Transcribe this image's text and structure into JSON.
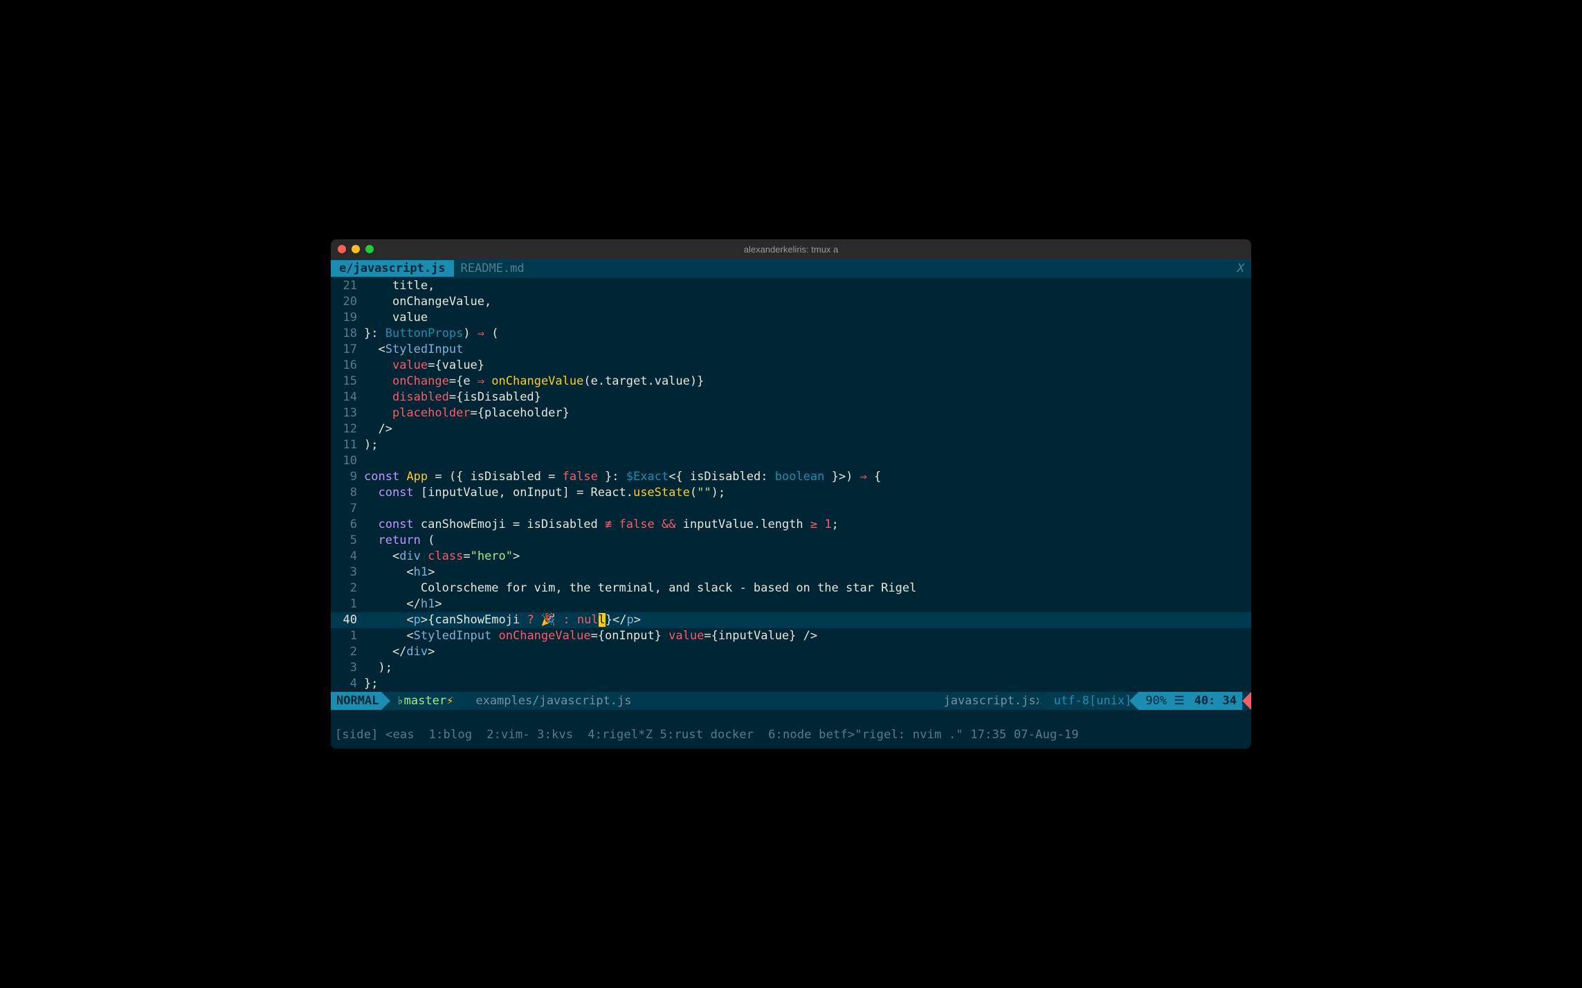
{
  "window": {
    "title": "alexanderkeliris: tmux a"
  },
  "tabs": {
    "active": "e/javascript.js",
    "inactive": "README.md",
    "close": "X"
  },
  "lines": [
    {
      "n": "21",
      "rel": false,
      "tokens": [
        [
          "fg",
          "    "
        ],
        [
          "fg",
          "title"
        ],
        [
          "fg",
          ","
        ]
      ]
    },
    {
      "n": "20",
      "rel": false,
      "tokens": [
        [
          "fg",
          "    "
        ],
        [
          "fg",
          "onChangeValue"
        ],
        [
          "fg",
          ","
        ]
      ]
    },
    {
      "n": "19",
      "rel": false,
      "tokens": [
        [
          "fg",
          "    "
        ],
        [
          "fg",
          "value"
        ]
      ]
    },
    {
      "n": "18",
      "rel": false,
      "tokens": [
        [
          "fg",
          "}: "
        ],
        [
          "type",
          "ButtonProps"
        ],
        [
          "fg",
          ") "
        ],
        [
          "op",
          "⇒"
        ],
        [
          "fg",
          " ("
        ]
      ]
    },
    {
      "n": "17",
      "rel": false,
      "tokens": [
        [
          "fg",
          "  "
        ],
        [
          "fg",
          "<"
        ],
        [
          "comp",
          "StyledInput"
        ]
      ]
    },
    {
      "n": "16",
      "rel": false,
      "tokens": [
        [
          "fg",
          "    "
        ],
        [
          "attr",
          "value"
        ],
        [
          "fg",
          "={value}"
        ]
      ]
    },
    {
      "n": "15",
      "rel": false,
      "tokens": [
        [
          "fg",
          "    "
        ],
        [
          "attr",
          "onChange"
        ],
        [
          "fg",
          "={e "
        ],
        [
          "op",
          "⇒"
        ],
        [
          "fg",
          " "
        ],
        [
          "fn",
          "onChangeValue"
        ],
        [
          "fg",
          "(e.target.value)}"
        ]
      ]
    },
    {
      "n": "14",
      "rel": false,
      "tokens": [
        [
          "fg",
          "    "
        ],
        [
          "attr",
          "disabled"
        ],
        [
          "fg",
          "={isDisabled}"
        ]
      ]
    },
    {
      "n": "13",
      "rel": false,
      "tokens": [
        [
          "fg",
          "    "
        ],
        [
          "attr",
          "placeholder"
        ],
        [
          "fg",
          "={placeholder}"
        ]
      ]
    },
    {
      "n": "12",
      "rel": false,
      "tokens": [
        [
          "fg",
          "  "
        ],
        [
          "fg",
          "/>"
        ]
      ]
    },
    {
      "n": "11",
      "rel": false,
      "tokens": [
        [
          "fg",
          ");"
        ]
      ]
    },
    {
      "n": "10",
      "rel": false,
      "tokens": [
        [
          "fg",
          ""
        ]
      ]
    },
    {
      "n": "9",
      "rel": false,
      "tokens": [
        [
          "kw",
          "const"
        ],
        [
          "fg",
          " "
        ],
        [
          "fn",
          "App"
        ],
        [
          "fg",
          " = ({ isDisabled = "
        ],
        [
          "val",
          "false"
        ],
        [
          "fg",
          " }: "
        ],
        [
          "type",
          "$Exact"
        ],
        [
          "fg",
          "<{ isDisabled: "
        ],
        [
          "type",
          "boolean"
        ],
        [
          "fg",
          " }>) "
        ],
        [
          "op",
          "⇒"
        ],
        [
          "fg",
          " {"
        ]
      ]
    },
    {
      "n": "8",
      "rel": false,
      "tokens": [
        [
          "fg",
          "  "
        ],
        [
          "kw",
          "const"
        ],
        [
          "fg",
          " [inputValue, onInput] = React."
        ],
        [
          "fn",
          "useState"
        ],
        [
          "fg",
          "("
        ],
        [
          "str",
          "\"\""
        ],
        [
          "fg",
          ");"
        ]
      ]
    },
    {
      "n": "7",
      "rel": false,
      "tokens": [
        [
          "fg",
          ""
        ]
      ]
    },
    {
      "n": "6",
      "rel": false,
      "tokens": [
        [
          "fg",
          "  "
        ],
        [
          "kw",
          "const"
        ],
        [
          "fg",
          " canShowEmoji = isDisabled "
        ],
        [
          "op",
          "≢"
        ],
        [
          "fg",
          " "
        ],
        [
          "val",
          "false"
        ],
        [
          "fg",
          " "
        ],
        [
          "op",
          "&&"
        ],
        [
          "fg",
          " inputValue.length "
        ],
        [
          "op",
          "≥"
        ],
        [
          "fg",
          " "
        ],
        [
          "val",
          "1"
        ],
        [
          "fg",
          ";"
        ]
      ]
    },
    {
      "n": "5",
      "rel": false,
      "tokens": [
        [
          "fg",
          "  "
        ],
        [
          "kw",
          "return"
        ],
        [
          "fg",
          " ("
        ]
      ]
    },
    {
      "n": "4",
      "rel": false,
      "tokens": [
        [
          "fg",
          "    <"
        ],
        [
          "comp",
          "div"
        ],
        [
          "fg",
          " "
        ],
        [
          "attr",
          "class"
        ],
        [
          "fg",
          "="
        ],
        [
          "str",
          "\"hero\""
        ],
        [
          "fg",
          ">"
        ]
      ]
    },
    {
      "n": "3",
      "rel": false,
      "tokens": [
        [
          "fg",
          "      <"
        ],
        [
          "comp",
          "h1"
        ],
        [
          "fg",
          ">"
        ]
      ]
    },
    {
      "n": "2",
      "rel": false,
      "tokens": [
        [
          "fg",
          "        Colorscheme for vim, the terminal, and slack - based on the star Rigel"
        ]
      ]
    },
    {
      "n": "1",
      "rel": false,
      "tokens": [
        [
          "fg",
          "      </"
        ],
        [
          "comp",
          "h1"
        ],
        [
          "fg",
          ">"
        ]
      ]
    },
    {
      "n": "40",
      "rel": true,
      "tokens": [
        [
          "fg",
          "      <"
        ],
        [
          "comp",
          "p"
        ],
        [
          "fg",
          ">{canShowEmoji "
        ],
        [
          "op",
          "?"
        ],
        [
          "fg",
          " 🎉 "
        ],
        [
          "op",
          ":"
        ],
        [
          "fg",
          " "
        ],
        [
          "val",
          "nul"
        ],
        [
          "cursor",
          "l"
        ],
        [
          "fg",
          "}</"
        ],
        [
          "comp",
          "p"
        ],
        [
          "fg",
          ">"
        ]
      ]
    },
    {
      "n": "1",
      "rel": false,
      "tokens": [
        [
          "fg",
          "      <"
        ],
        [
          "comp",
          "StyledInput"
        ],
        [
          "fg",
          " "
        ],
        [
          "attr",
          "onChangeValue"
        ],
        [
          "fg",
          "={onInput} "
        ],
        [
          "attr",
          "value"
        ],
        [
          "fg",
          "={inputValue} />"
        ]
      ]
    },
    {
      "n": "2",
      "rel": false,
      "tokens": [
        [
          "fg",
          "    </"
        ],
        [
          "comp",
          "div"
        ],
        [
          "fg",
          ">"
        ]
      ]
    },
    {
      "n": "3",
      "rel": false,
      "tokens": [
        [
          "fg",
          "  );"
        ]
      ]
    },
    {
      "n": "4",
      "rel": false,
      "tokens": [
        [
          "fg",
          "};"
        ]
      ]
    }
  ],
  "status": {
    "mode": "NORMAL",
    "branch_icon": "♭",
    "branch": "master",
    "bolt": "⚡",
    "file": "examples/javascript.js",
    "filetype": "javascript.jsx",
    "encoding": "utf-8[unix]",
    "percent": "90% ☰",
    "position": "40: 34"
  },
  "tmux": "[side] <eas  1:blog  2:vim- 3:kvs  4:rigel*Z 5:rust docker  6:node betf>\"rigel: nvim .\" 17:35 07-Aug-19"
}
